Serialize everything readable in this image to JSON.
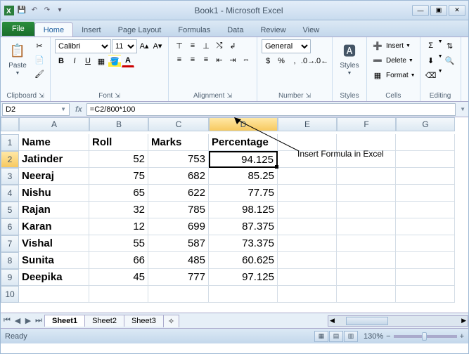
{
  "title": "Book1 - Microsoft Excel",
  "tabs": {
    "file": "File",
    "items": [
      "Home",
      "Insert",
      "Page Layout",
      "Formulas",
      "Data",
      "Review",
      "View"
    ]
  },
  "ribbon": {
    "clipboard": {
      "paste": "Paste",
      "label": "Clipboard"
    },
    "font": {
      "name": "Calibri",
      "size": "11",
      "label": "Font"
    },
    "alignment": {
      "label": "Alignment"
    },
    "number": {
      "format": "General",
      "label": "Number"
    },
    "styles": {
      "btn": "Styles",
      "label": "Styles"
    },
    "cells": {
      "insert": "Insert",
      "delete": "Delete",
      "format": "Format",
      "label": "Cells"
    },
    "editing": {
      "label": "Editing"
    }
  },
  "namebox": "D2",
  "formula": "=C2/800*100",
  "columns": [
    "A",
    "B",
    "C",
    "D",
    "E",
    "F",
    "G"
  ],
  "headers": [
    "Name",
    "Roll",
    "Marks",
    "Percentage"
  ],
  "rows": [
    {
      "n": "1",
      "name": "Name",
      "roll": "Roll",
      "marks": "Marks",
      "pct": "Percentage",
      "bold": true
    },
    {
      "n": "2",
      "name": "Jatinder",
      "roll": "52",
      "marks": "753",
      "pct": "94.125",
      "bold": false,
      "sel": true
    },
    {
      "n": "3",
      "name": "Neeraj",
      "roll": "75",
      "marks": "682",
      "pct": "85.25"
    },
    {
      "n": "4",
      "name": "Nishu",
      "roll": "65",
      "marks": "622",
      "pct": "77.75"
    },
    {
      "n": "5",
      "name": "Rajan",
      "roll": "32",
      "marks": "785",
      "pct": "98.125"
    },
    {
      "n": "6",
      "name": "Karan",
      "roll": "12",
      "marks": "699",
      "pct": "87.375"
    },
    {
      "n": "7",
      "name": "Vishal",
      "roll": "55",
      "marks": "587",
      "pct": "73.375"
    },
    {
      "n": "8",
      "name": "Sunita",
      "roll": "66",
      "marks": "485",
      "pct": "60.625"
    },
    {
      "n": "9",
      "name": "Deepika",
      "roll": "45",
      "marks": "777",
      "pct": "97.125"
    },
    {
      "n": "10",
      "name": "",
      "roll": "",
      "marks": "",
      "pct": ""
    }
  ],
  "annotation": "Insert Formula in Excel",
  "sheets": [
    "Sheet1",
    "Sheet2",
    "Sheet3"
  ],
  "status": {
    "ready": "Ready",
    "zoom": "130%"
  }
}
